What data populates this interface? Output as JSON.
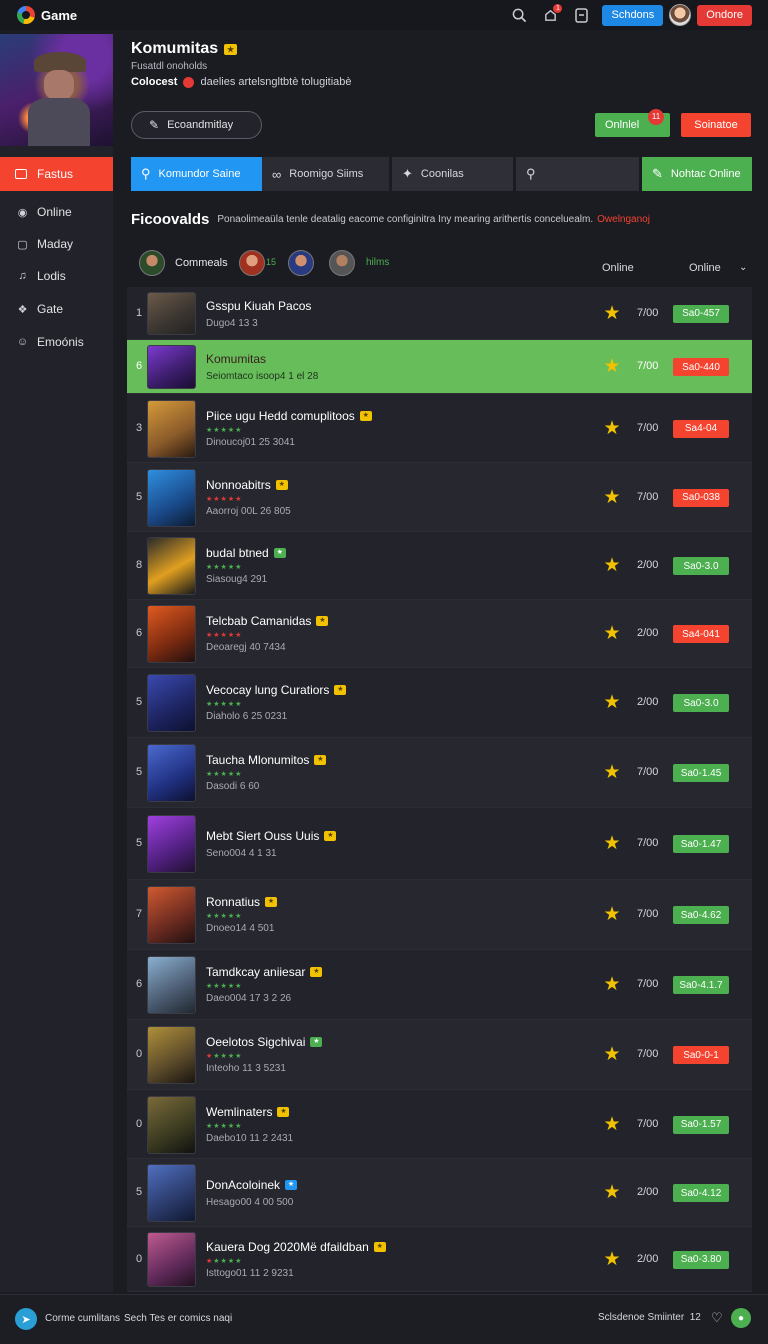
{
  "app": {
    "title": "Game"
  },
  "topbar": {
    "notif_count": "1",
    "blue_button": "Schdons",
    "red_button": "Ondore"
  },
  "sidebar": {
    "active": "Fastus",
    "items": [
      {
        "label": "Online",
        "icon": "chat-icon"
      },
      {
        "label": "Maday",
        "icon": "bag-icon"
      },
      {
        "label": "Lodis",
        "icon": "music-icon"
      },
      {
        "label": "Gate",
        "icon": "controller-icon"
      },
      {
        "label": "Emoónis",
        "icon": "emoji-icon"
      }
    ]
  },
  "header": {
    "title": "Komumitas",
    "subtitle": "Fusatdl onoholds",
    "line_bold": "Colocest",
    "line_text": "daelies artelsngltbtè tolugitiabè",
    "pill_button": "Ecoandmitlay",
    "green_button": "Onlnlel",
    "green_badge": "11",
    "red_button": "Soinatoe"
  },
  "tabs": [
    {
      "label": "Komundor Saine",
      "icon": "search-icon"
    },
    {
      "label": "Roomigo Siims",
      "icon": "link-icon"
    },
    {
      "label": "Coonilas",
      "icon": "spark-icon"
    },
    {
      "label": "",
      "icon": "search-icon"
    },
    {
      "label": "Nohtac Online",
      "icon": "pencil-icon"
    }
  ],
  "intro": {
    "title": "Ficoovalds",
    "desc": "Ponaolimeaüla tenle deatalig eacome configinitra Iny mearing arithertis conceluealm.",
    "link": "Owelnganoj"
  },
  "filters": {
    "label1": "Commeals",
    "count": "15",
    "label2": "hilms",
    "col1": "Online",
    "col2": "Online"
  },
  "rows": [
    {
      "rank": "1",
      "name": "Gsspu Kiuah Pacos",
      "sub": "Dugo4 13 3",
      "score": "7/00",
      "status": "Sa0-457",
      "tone": "g",
      "badge": "",
      "stars": ""
    },
    {
      "rank": "6",
      "name": "Komumitas",
      "sub": "Seiomtaco isoop4 1 el 28",
      "score": "7/00",
      "status": "Sa0-440",
      "tone": "r",
      "badge": "",
      "stars": ""
    },
    {
      "rank": "3",
      "name": "Piice ugu Hedd comuplitoos",
      "sub": "Dinoucoj01 25 3041",
      "score": "7/00",
      "status": "Sa4-04",
      "tone": "r",
      "badge": "y",
      "stars": "g"
    },
    {
      "rank": "5",
      "name": "Nonnoabitrs",
      "sub": "Aaorroj 00L 26 805",
      "score": "7/00",
      "status": "Sa0-038",
      "tone": "r",
      "badge": "y",
      "stars": "r"
    },
    {
      "rank": "8",
      "name": "budal btned",
      "sub": "Siasoug4 291",
      "score": "2/00",
      "status": "Sa0-3.0",
      "tone": "g",
      "badge": "g",
      "stars": "g"
    },
    {
      "rank": "6",
      "name": "Telcbab Camanidas",
      "sub": "Deoaregj 40 7434",
      "score": "2/00",
      "status": "Sa4-041",
      "tone": "r",
      "badge": "y",
      "stars": "r"
    },
    {
      "rank": "5",
      "name": "Vecocay lung Curatiors",
      "sub": "Diaholo 6 25 0231",
      "score": "2/00",
      "status": "Sa0-3.0",
      "tone": "g",
      "badge": "y",
      "stars": "g"
    },
    {
      "rank": "5",
      "name": "Taucha Mlonumitos",
      "sub": "Dasodi 6 60",
      "score": "7/00",
      "status": "Sa0-1.45",
      "tone": "g",
      "badge": "y",
      "stars": "g"
    },
    {
      "rank": "5",
      "name": "Mebt Siert Ouss Uuis",
      "sub": "Seno004 4 1 31",
      "score": "7/00",
      "status": "Sa0-1.47",
      "tone": "g",
      "badge": "y",
      "stars": ""
    },
    {
      "rank": "7",
      "name": "Ronnatius",
      "sub": "Dnoeo14 4 501",
      "score": "7/00",
      "status": "Sa0-4.62",
      "tone": "g",
      "badge": "y",
      "stars": "g"
    },
    {
      "rank": "6",
      "name": "Tamdkcay aniiesar",
      "sub": "Daeo004 17 3 2 26",
      "score": "7/00",
      "status": "Sa0-4.1.7",
      "tone": "g",
      "badge": "y",
      "stars": "g"
    },
    {
      "rank": "0",
      "name": "Oeelotos Sigchivai",
      "sub": "Inteoho 11 3 5231",
      "score": "7/00",
      "status": "Sa0-0-1",
      "tone": "r",
      "badge": "g",
      "stars": "mix"
    },
    {
      "rank": "0",
      "name": "Wemlinaters",
      "sub": "Daebo10 11 2 2431",
      "score": "7/00",
      "status": "Sa0-1.57",
      "tone": "g",
      "badge": "y",
      "stars": "g"
    },
    {
      "rank": "5",
      "name": "DonAcoloinek",
      "sub": "Hesago00 4 00 500",
      "score": "2/00",
      "status": "Sa0-4.12",
      "tone": "g",
      "badge": "b",
      "stars": ""
    },
    {
      "rank": "0",
      "name": "Kauera Dog 2020Më dfaildban",
      "sub": "Isttogo01 11 2 9231",
      "score": "2/00",
      "status": "Sa0-3.80",
      "tone": "g",
      "badge": "y",
      "stars": "mix"
    }
  ],
  "footer": {
    "t1": "Corme cumlitans",
    "t2": "Sech Tes er comics naqi",
    "right": "Sclsdenoe Smiinter",
    "count": "12"
  }
}
